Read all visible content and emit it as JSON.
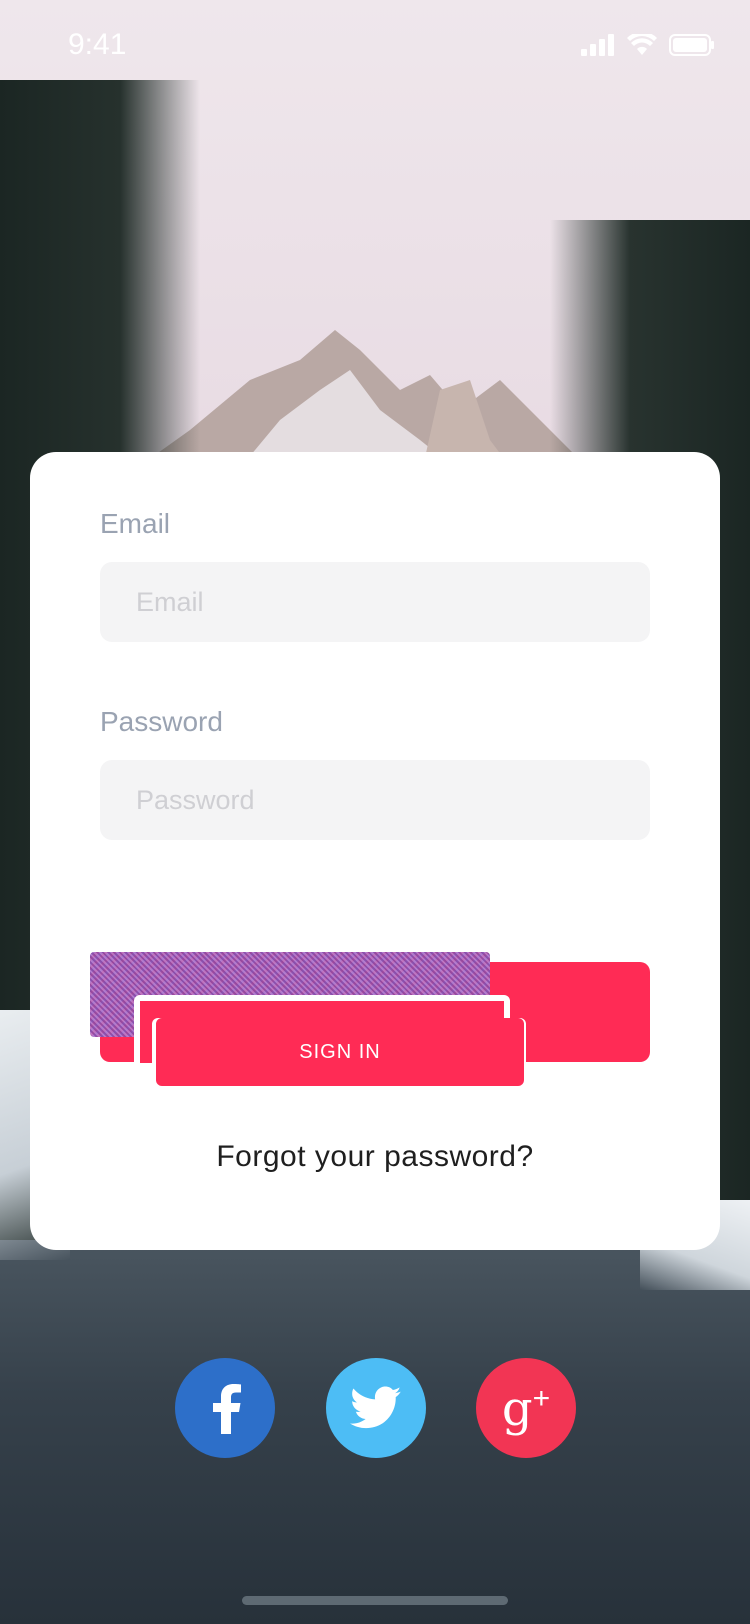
{
  "status_bar": {
    "time": "9:41",
    "icons": [
      "signal-icon",
      "wifi-icon",
      "battery-icon"
    ]
  },
  "login": {
    "email": {
      "label": "Email",
      "placeholder": "Email",
      "value": ""
    },
    "password": {
      "label": "Password",
      "placeholder": "Password",
      "value": ""
    },
    "sign_in_label": "SIGN IN",
    "forgot_label": "Forgot your password?"
  },
  "social": [
    {
      "name": "facebook",
      "icon": "facebook-icon",
      "color": "#2d6fc9"
    },
    {
      "name": "twitter",
      "icon": "twitter-icon",
      "color": "#4dbdf5"
    },
    {
      "name": "google-plus",
      "icon": "google-plus-icon",
      "color": "#f23554"
    }
  ],
  "colors": {
    "accent": "#ff2b55",
    "card": "#ffffff",
    "field": "#f4f4f5",
    "label": "#9aa3b2"
  }
}
